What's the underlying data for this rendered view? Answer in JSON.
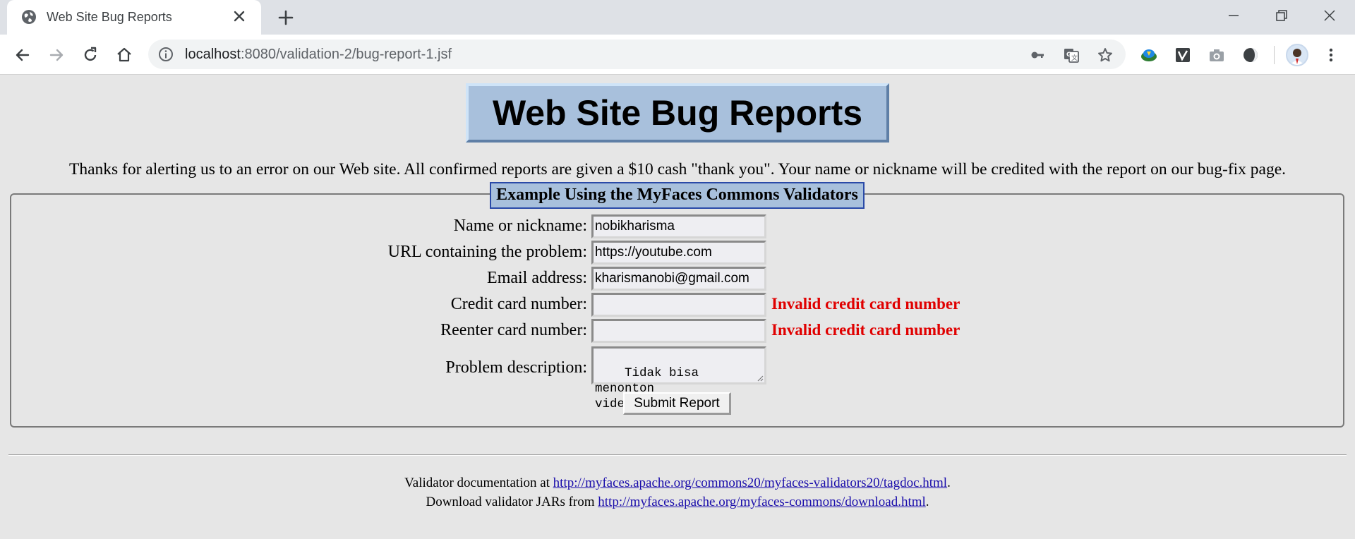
{
  "browser": {
    "tab_title": "Web Site Bug Reports",
    "url_host": "localhost",
    "url_rest": ":8080/validation-2/bug-report-1.jsf"
  },
  "page": {
    "banner": "Web Site Bug Reports",
    "intro": "Thanks for alerting us to an error on our Web site. All confirmed reports are given a $10 cash \"thank you\". Your name or nickname will be credited with the report on our bug-fix page.",
    "legend": "Example Using the MyFaces Commons Validators",
    "form": {
      "name_label": "Name or nickname:",
      "name_value": "nobikharisma",
      "url_label": "URL containing the problem:",
      "url_value": "https://youtube.com",
      "email_label": "Email address:",
      "email_value": "kharismanobi@gmail.com",
      "cc_label": "Credit card number:",
      "cc_value": "",
      "cc_error": "Invalid credit card number",
      "cc2_label": "Reenter card number:",
      "cc2_value": "",
      "cc2_error": "Invalid credit card number",
      "desc_label": "Problem description:",
      "desc_value": "Tidak bisa menonton\nvideo",
      "submit_label": "Submit Report"
    },
    "footer": {
      "line1_prefix": "Validator documentation at ",
      "line1_link": "http://myfaces.apache.org/commons20/myfaces-validators20/tagdoc.html",
      "line1_suffix": ".",
      "line2_prefix": "Download validator JARs from ",
      "line2_link": "http://myfaces.apache.org/myfaces-commons/download.html",
      "line2_suffix": "."
    }
  },
  "colors": {
    "page_bg": "#e6e6e6",
    "banner_bg": "#a8c0dc",
    "error": "#e00000",
    "link": "#1a0dab"
  }
}
